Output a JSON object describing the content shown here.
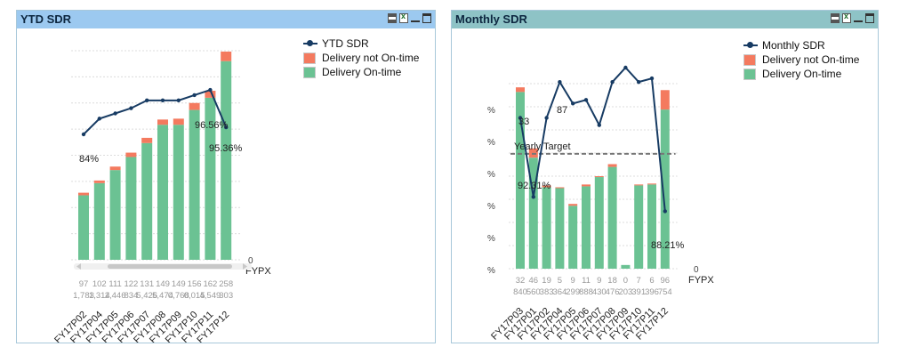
{
  "colors": {
    "ontime": "#6bc293",
    "notontime": "#f47a5f",
    "line": "#173b63",
    "target": "#777777"
  },
  "ytd": {
    "caption": "YTD SDR",
    "legend": {
      "line": "YTD SDR",
      "late": "Delivery not On-time",
      "ontime": "Delivery On-time"
    },
    "right_axis_tick": "0",
    "x_title": "FYPX",
    "labels": [
      "84%",
      "96.56%",
      "95.36%"
    ],
    "categories": [
      "FY17P02",
      "FY17P04",
      "FY17P05",
      "FY17P06",
      "FY17P07",
      "FY17P08",
      "FY17P09",
      "FY17P10",
      "FY17P11",
      "FY17P12"
    ],
    "values_row1": [
      "97",
      "102",
      "111",
      "122",
      "131",
      "149",
      "149",
      "156",
      "162",
      "258"
    ],
    "values_row2": [
      "1,783",
      "1,314",
      "2,446",
      "834",
      "5,426",
      "5,474",
      "0,768",
      "0,015",
      "4,549",
      "303"
    ]
  },
  "monthly": {
    "caption": "Monthly SDR",
    "legend": {
      "line": "Monthly SDR",
      "late": "Delivery not On-time",
      "ontime": "Delivery On-time"
    },
    "target_label": "Yearly Target",
    "right_axis_tick": "0",
    "x_title": "FYPX",
    "left_ticks": [
      "%",
      "%",
      "%",
      "%",
      "%",
      "%"
    ],
    "labels": [
      "33",
      "92.31%",
      "87",
      "88.21%"
    ],
    "categories": [
      "FY17P03",
      "FY17P01",
      "FY17P02",
      "FY17P04",
      "FY17P05",
      "FY17P06",
      "FY17P07",
      "FY17P08",
      "FY17P09",
      "FY17P10",
      "FY17P11",
      "FY17P12"
    ],
    "values_row1": [
      "32",
      "46",
      "19",
      "5",
      "9",
      "11",
      "9",
      "18",
      "0",
      "7",
      "6",
      "96"
    ],
    "values_row2": [
      "840",
      "560",
      "383",
      "364",
      "299",
      "888",
      "430",
      "476",
      "203",
      "391",
      "396",
      "754"
    ]
  },
  "chart_data": [
    {
      "type": "bar",
      "title": "YTD SDR",
      "xlabel": "FYPX",
      "categories": [
        "FY17P02",
        "FY17P04",
        "FY17P05",
        "FY17P06",
        "FY17P07",
        "FY17P08",
        "FY17P09",
        "FY17P10",
        "FY17P11",
        "FY17P12"
      ],
      "series": [
        {
          "name": "Delivery On-time",
          "values": [
            74,
            88,
            103,
            118,
            134,
            155,
            155,
            172,
            186,
            228
          ]
        },
        {
          "name": "Delivery not On-time",
          "values": [
            3,
            3,
            4,
            5,
            6,
            6,
            7,
            8,
            8,
            11
          ]
        },
        {
          "name": "YTD SDR",
          "values": [
            0.84,
            0.87,
            0.88,
            0.89,
            0.905,
            0.905,
            0.905,
            0.915,
            0.925,
            0.8536
          ]
        }
      ]
    },
    {
      "type": "bar",
      "title": "Monthly SDR",
      "xlabel": "FYPX",
      "categories": [
        "FY17P03",
        "FY17P01",
        "FY17P02",
        "FY17P04",
        "FY17P05",
        "FY17P06",
        "FY17P07",
        "FY17P08",
        "FY17P09",
        "FY17P10",
        "FY17P11",
        "FY17P12"
      ],
      "series": [
        {
          "name": "Delivery On-time",
          "values": [
            191,
            120,
            88,
            87,
            68,
            89,
            99,
            110,
            4,
            90,
            91,
            172
          ]
        },
        {
          "name": "Delivery not On-time",
          "values": [
            5,
            10,
            2,
            1,
            2,
            2,
            1,
            3,
            0,
            1,
            1,
            21
          ]
        },
        {
          "name": "Monthly SDR",
          "values": [
            0.93,
            0.82,
            0.93,
            0.98,
            0.95,
            0.955,
            0.92,
            0.98,
            1.0,
            0.98,
            0.985,
            0.8
          ]
        }
      ],
      "target": 0.88
    }
  ]
}
